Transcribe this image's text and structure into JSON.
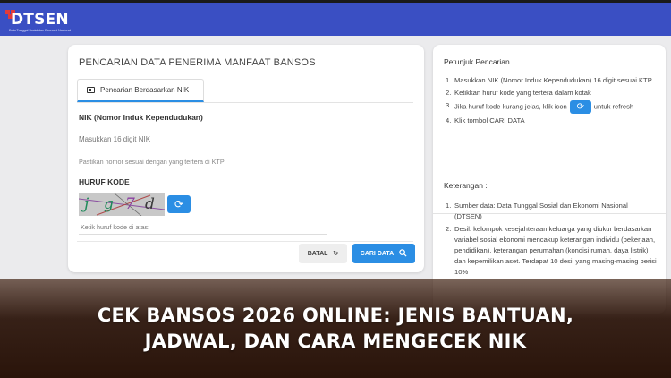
{
  "header": {
    "logo_text": "DTSEN",
    "logo_subtext": "Data Tunggal Sosial dan Ekonomi Nasional",
    "brand_color": "#3a4fc3",
    "accent_color": "#2b8ee4"
  },
  "form": {
    "title": "PENCARIAN DATA PENERIMA MANFAAT BANSOS",
    "tab_label": "Pencarian Berdasarkan NIK",
    "tab_icon": "id-card-icon",
    "nik_label": "NIK (Nomor Induk Kependudukan)",
    "nik_placeholder": "Masukkan 16 digit NIK",
    "nik_help": "Pastikan nomor sesuai dengan yang tertera di KTP",
    "kode_label": "HURUF KODE",
    "captcha_chars": [
      "j",
      "g",
      "7",
      "d"
    ],
    "kode_placeholder": "Ketik huruf kode di atas:",
    "batal_label": "BATAL",
    "cari_label": "CARI DATA"
  },
  "petunjuk": {
    "title": "Petunjuk Pencarian",
    "steps": [
      "Masukkan NIK (Nomor Induk Kependudukan) 16 digit sesuai KTP",
      "Ketikkan huruf kode yang tertera dalam kotak",
      "Jika huruf kode kurang jelas, klik icon",
      "untuk refresh",
      "Klik tombol CARI DATA"
    ]
  },
  "keterangan": {
    "title": "Keterangan :",
    "items": [
      "Sumber data: Data Tunggal Sosial dan Ekonomi Nasional (DTSEN)",
      "Desil: kelompok kesejahteraan keluarga yang diukur berdasarkan variabel sosial ekonomi mencakup keterangan individu (pekerjaan, pendidikan), keterangan perumahan (kondisi rumah, daya listrik) dan kepemilikan aset. Terdapat 10 desil yang masing-masing berisi 10%"
    ]
  },
  "headline": {
    "line1": "CEK BANSOS 2026 ONLINE: JENIS BANTUAN,",
    "line2": "JADWAL, DAN CARA MENGECEK NIK"
  }
}
